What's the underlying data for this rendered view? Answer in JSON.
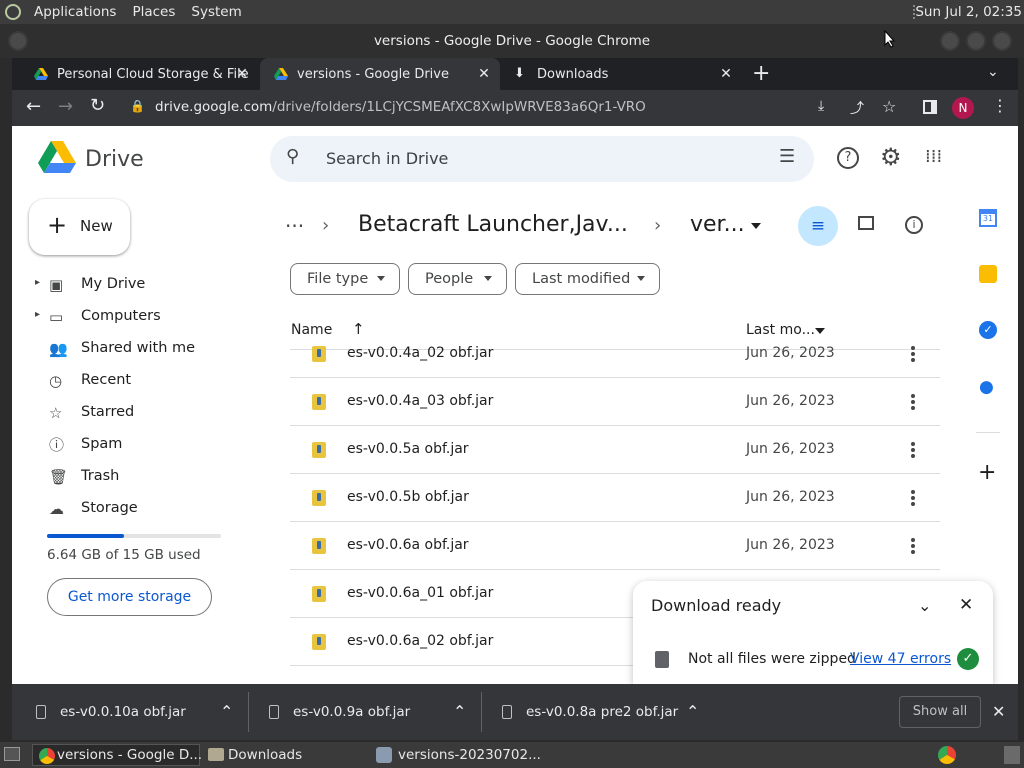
{
  "topbar": {
    "menus": [
      "Applications",
      "Places",
      "System"
    ],
    "clock": "Sun Jul  2, 02:35"
  },
  "window": {
    "title": "versions - Google Drive - Google Chrome"
  },
  "tabs": [
    {
      "label": "Personal Cloud Storage & File",
      "icon": "google-drive-icon"
    },
    {
      "label": "versions - Google Drive",
      "icon": "google-drive-icon"
    },
    {
      "label": "Downloads",
      "icon": "download-icon"
    }
  ],
  "address": {
    "domain": "drive.google.com",
    "path": "/drive/folders/1LCjYCSMEAfXC8XwIpWRVE83a6Qr1-VRO"
  },
  "profile_initial": "N",
  "drive": {
    "title": "Drive",
    "search_placeholder": "Search in Drive",
    "new_label": "New",
    "nav": [
      {
        "label": "My Drive",
        "icon": "my-drive-icon",
        "caret": true
      },
      {
        "label": "Computers",
        "icon": "computers-icon",
        "caret": true
      },
      {
        "label": "Shared with me",
        "icon": "shared-icon",
        "caret": false
      },
      {
        "label": "Recent",
        "icon": "clock-icon",
        "caret": false
      },
      {
        "label": "Starred",
        "icon": "star-icon",
        "caret": false
      },
      {
        "label": "Spam",
        "icon": "spam-icon",
        "caret": false
      },
      {
        "label": "Trash",
        "icon": "trash-icon",
        "caret": false
      },
      {
        "label": "Storage",
        "icon": "cloud-icon",
        "caret": false
      }
    ],
    "storage_text": "6.64 GB of 15 GB used",
    "storage_fraction": 0.443,
    "get_more_storage": "Get more storage",
    "breadcrumb": {
      "parent": "Betacraft Launcher,Jav...",
      "current": "ver..."
    },
    "filters": [
      "File type",
      "People",
      "Last modified"
    ],
    "columns": {
      "name": "Name",
      "modified": "Last mo..."
    },
    "files": [
      {
        "name": "es-v0.0.4a_02 obf.jar",
        "date": "Jun 26, 2023"
      },
      {
        "name": "es-v0.0.4a_03 obf.jar",
        "date": "Jun 26, 2023"
      },
      {
        "name": "es-v0.0.5a obf.jar",
        "date": "Jun 26, 2023"
      },
      {
        "name": "es-v0.0.5b obf.jar",
        "date": "Jun 26, 2023"
      },
      {
        "name": "es-v0.0.6a obf.jar",
        "date": "Jun 26, 2023"
      },
      {
        "name": "es-v0.0.6a_01 obf.jar",
        "date": ""
      },
      {
        "name": "es-v0.0.6a_02 obf.jar",
        "date": ""
      }
    ]
  },
  "toast": {
    "title": "Download ready",
    "message": "Not all files were zipped",
    "link": "View 47 errors"
  },
  "downloads_shelf": {
    "items": [
      "es-v0.0.10a obf.jar",
      "es-v0.0.9a obf.jar",
      "es-v0.0.8a pre2 obf.jar"
    ],
    "show_all": "Show all"
  },
  "taskbar": {
    "items": [
      "versions - Google D...",
      "Downloads",
      "versions-20230702..."
    ]
  },
  "colors": {
    "accent": "#0b57d0",
    "avatar": "#b3174d",
    "selected_chip": "#c2e7ff"
  }
}
